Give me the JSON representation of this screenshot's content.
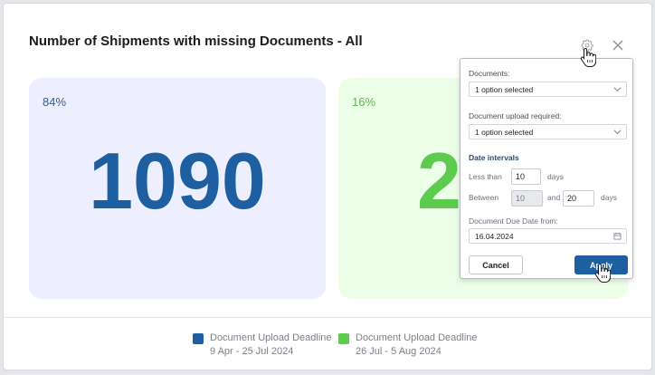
{
  "widget": {
    "title": "Number of Shipments with missing Documents - All"
  },
  "toolbar": {
    "settings_icon": "gear-icon",
    "close_icon": "close-icon"
  },
  "tiles": [
    {
      "percent": "84%",
      "count": "1090",
      "color": "#1d5fa1",
      "background": "#edefff"
    },
    {
      "percent": "16%",
      "count": "2",
      "color": "#5ccb4e",
      "background": "#ecfde8"
    }
  ],
  "legend": [
    {
      "label": "Document Upload Deadline",
      "range": "9 Apr - 25 Jul 2024",
      "color": "#1d5fa1"
    },
    {
      "label": "Document Upload Deadline",
      "range": "26 Jul - 5 Aug 2024",
      "color": "#5ccb4e"
    }
  ],
  "settings_panel": {
    "documents_label": "Documents:",
    "documents_value": "1 option selected",
    "upload_required_label": "Document upload required:",
    "upload_required_value": "1 option selected",
    "date_intervals_label": "Date intervals",
    "less_than_label": "Less than",
    "less_than_value": "10",
    "days_label": "days",
    "between_label": "Between",
    "between_from_value": "10",
    "and_label": "and",
    "between_to_value": "20",
    "due_date_label": "Document Due Date from:",
    "due_date_value": "16.04.2024",
    "cancel_label": "Cancel",
    "apply_label": "Apply"
  }
}
